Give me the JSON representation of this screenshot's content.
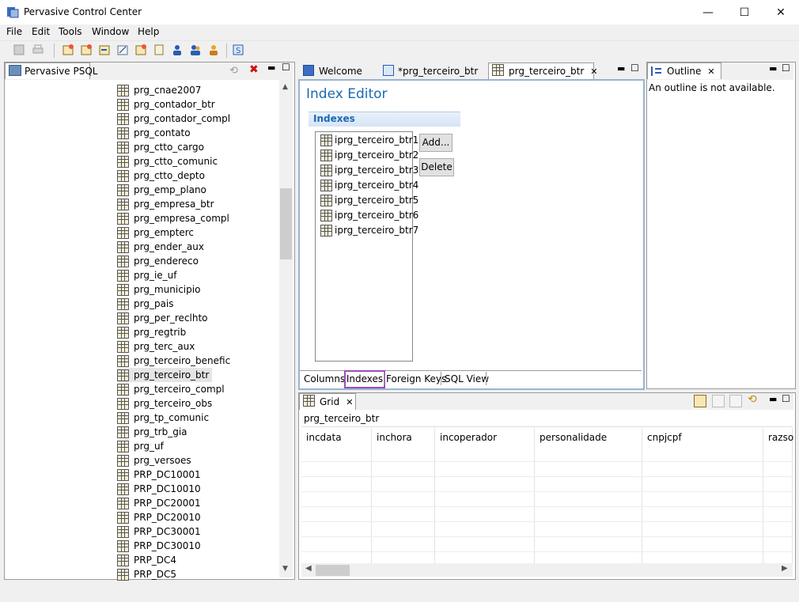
{
  "window": {
    "title": "Pervasive Control Center",
    "minimize": "—",
    "maximize": "☐",
    "close": "✕"
  },
  "menu": [
    "File",
    "Edit",
    "Tools",
    "Window",
    "Help"
  ],
  "left_panel": {
    "tab": "Pervasive PSQL",
    "items": [
      "prg_cnae2007",
      "prg_contador_btr",
      "prg_contador_compl",
      "prg_contato",
      "prg_ctto_cargo",
      "prg_ctto_comunic",
      "prg_ctto_depto",
      "prg_emp_plano",
      "prg_empresa_btr",
      "prg_empresa_compl",
      "prg_empterc",
      "prg_ender_aux",
      "prg_endereco",
      "prg_ie_uf",
      "prg_municipio",
      "prg_pais",
      "prg_per_reclhto",
      "prg_regtrib",
      "prg_terc_aux",
      "prg_terceiro_benefic",
      "prg_terceiro_btr",
      "prg_terceiro_compl",
      "prg_terceiro_obs",
      "prg_tp_comunic",
      "prg_trb_gia",
      "prg_uf",
      "prg_versoes",
      "PRP_DC10001",
      "PRP_DC10010",
      "PRP_DC20001",
      "PRP_DC20010",
      "PRP_DC30001",
      "PRP_DC30010",
      "PRP_DC4",
      "PRP_DC5"
    ],
    "selected": "prg_terceiro_btr"
  },
  "editor": {
    "tabs": [
      "Welcome",
      "*prg_terceiro_btr",
      "prg_terceiro_btr"
    ],
    "heading": "Index Editor",
    "section": "Indexes",
    "indexes": [
      "iprg_terceiro_btr1",
      "iprg_terceiro_btr2",
      "iprg_terceiro_btr3",
      "iprg_terceiro_btr4",
      "iprg_terceiro_btr5",
      "iprg_terceiro_btr6",
      "iprg_terceiro_btr7"
    ],
    "add_label": "Add...",
    "delete_label": "Delete",
    "bottom_tabs": [
      "Columns",
      "Indexes",
      "Foreign Keys",
      "SQL View"
    ]
  },
  "outline": {
    "tab": "Outline",
    "message": "An outline is not available."
  },
  "grid": {
    "tab": "Grid",
    "table_name": "prg_terceiro_btr",
    "columns": [
      "incdata",
      "inchora",
      "incoperador",
      "personalidade",
      "cnpjcpf",
      "razso"
    ]
  }
}
